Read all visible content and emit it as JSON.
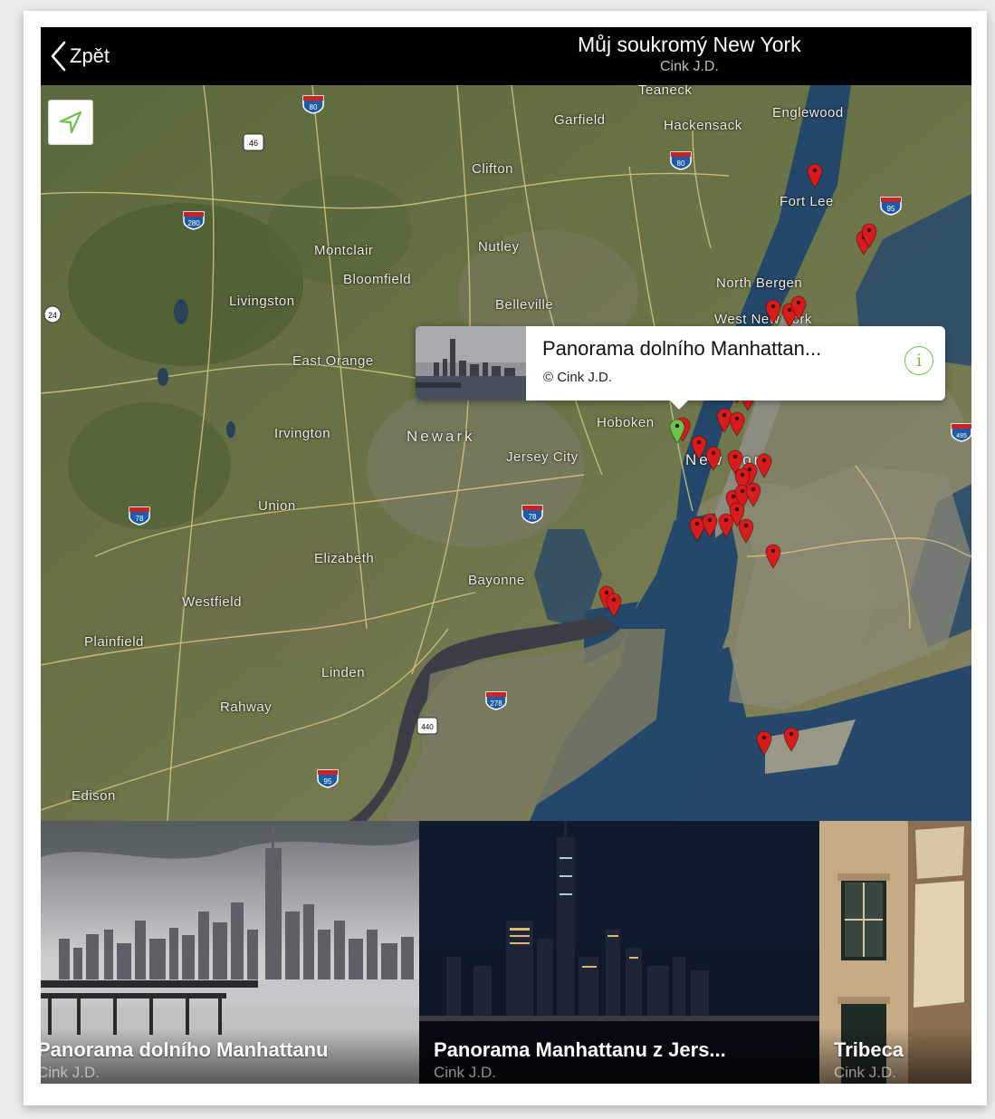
{
  "nav": {
    "back_label": "Zpět",
    "title": "Můj soukromý New York",
    "subtitle": "Cink J.D."
  },
  "map": {
    "places": [
      "Teaneck",
      "Garfield",
      "Hackensack",
      "Englewood",
      "Clifton",
      "Fort Lee",
      "Nutley",
      "Montclair",
      "Bloomfield",
      "North Bergen",
      "Livingston",
      "Belleville",
      "West New York",
      "East Orange",
      "Newark",
      "Hoboken",
      "Irvington",
      "Jersey City",
      "New York",
      "Union",
      "Elizabeth",
      "Bayonne",
      "Westfield",
      "Plainfield",
      "Linden",
      "Rahway",
      "Edison"
    ],
    "shields": [
      "80",
      "46",
      "80",
      "280",
      "95",
      "24",
      "78",
      "78",
      "278",
      "440",
      "95",
      "495"
    ],
    "pin_color": "#d81b1b",
    "selected_pin_color": "#6cc24a"
  },
  "callout": {
    "title": "Panorama dolního Manhattan...",
    "author": "© Cink J.D.",
    "info_icon": "i"
  },
  "gallery": [
    {
      "title": "Panorama dolního Manhattanu",
      "author": "Cink J.D."
    },
    {
      "title": "Panorama Manhattanu z Jers...",
      "author": "Cink J.D."
    },
    {
      "title": "Tribeca",
      "author": "Cink J.D."
    }
  ],
  "colors": {
    "accent": "#6cc24a",
    "nav_bg": "#000000",
    "water": "#24486a",
    "land": "#5f6b43"
  }
}
